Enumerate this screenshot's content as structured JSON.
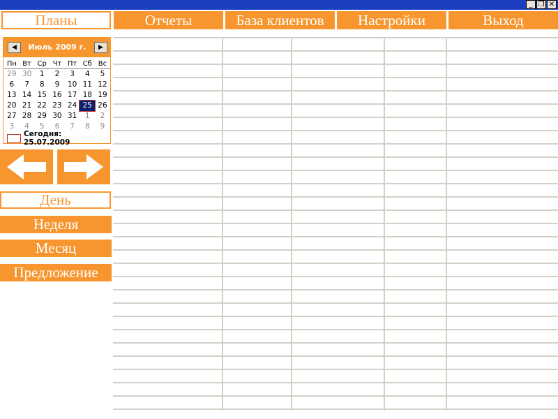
{
  "window": {
    "controls": {
      "minimize": "_",
      "restore": "❐",
      "close": "✕"
    }
  },
  "nav": {
    "plans": "Планы",
    "reports": "Отчеты",
    "clients": "База клиентов",
    "settings": "Настройки",
    "exit": "Выход"
  },
  "calendar": {
    "title": "Июль 2009 г.",
    "prev_icon": "◀",
    "next_icon": "▶",
    "weekdays": [
      "Пн",
      "Вт",
      "Ср",
      "Чт",
      "Пт",
      "Сб",
      "Вс"
    ],
    "weeks": [
      [
        "29",
        "30",
        "1",
        "2",
        "3",
        "4",
        "5"
      ],
      [
        "6",
        "7",
        "8",
        "9",
        "10",
        "11",
        "12"
      ],
      [
        "13",
        "14",
        "15",
        "16",
        "17",
        "18",
        "19"
      ],
      [
        "20",
        "21",
        "22",
        "23",
        "24",
        "25",
        "26"
      ],
      [
        "27",
        "28",
        "29",
        "30",
        "31",
        "1",
        "2"
      ],
      [
        "3",
        "4",
        "5",
        "6",
        "7",
        "8",
        "9"
      ]
    ],
    "selected_day": "25",
    "today_label": "Сегодня: 25.07.2009"
  },
  "views": {
    "day": "День",
    "week": "Неделя",
    "month": "Месяц",
    "offer": "Предложение"
  },
  "colors": {
    "accent": "#f7962e",
    "titlebar": "#1c3fbf",
    "grid_line": "#d4d0c8",
    "selected_day": "#0b1f6b"
  }
}
